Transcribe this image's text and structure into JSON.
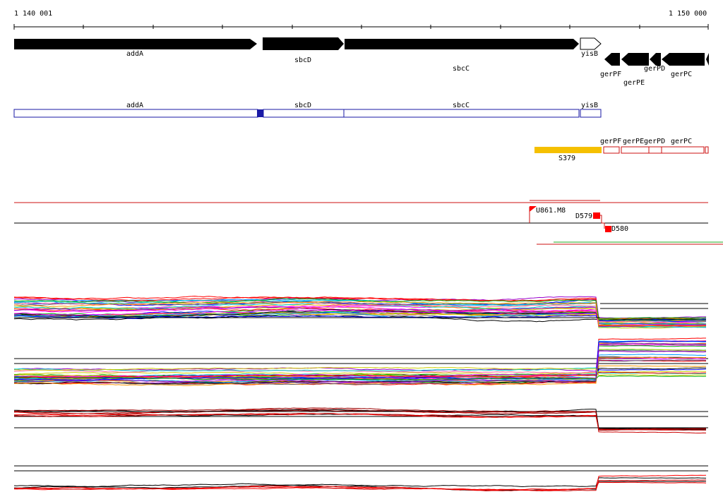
{
  "ruler": {
    "start_label": "1 140 001",
    "end_label": "1 150 000"
  },
  "genes": [
    {
      "name": "addA",
      "strand": "+",
      "filled": true
    },
    {
      "name": "sbcD",
      "strand": "+",
      "filled": true
    },
    {
      "name": "sbcC",
      "strand": "+",
      "filled": true
    },
    {
      "name": "yisB",
      "strand": "+",
      "filled": false
    },
    {
      "name": "gerPF",
      "strand": "-",
      "filled": true
    },
    {
      "name": "gerPE",
      "strand": "-",
      "filled": true
    },
    {
      "name": "gerPD",
      "strand": "-",
      "filled": true
    },
    {
      "name": "gerPC",
      "strand": "-",
      "filled": true
    }
  ],
  "transcript_units_blue": [
    "addA",
    "sbcD",
    "sbcC",
    "yisB"
  ],
  "transcript_units_red": [
    "gerPF",
    "gerPE",
    "gerPD",
    "gerPC"
  ],
  "segment_label": "S379",
  "markers": {
    "upshift": "U861.M8",
    "down1": "D579",
    "down2": "D580"
  },
  "colors": {
    "gene": "#000000",
    "blue_box": "#1a1aa6",
    "red_box": "#cc1111",
    "segment": "#f5c000",
    "marker": "#ff0000"
  }
}
